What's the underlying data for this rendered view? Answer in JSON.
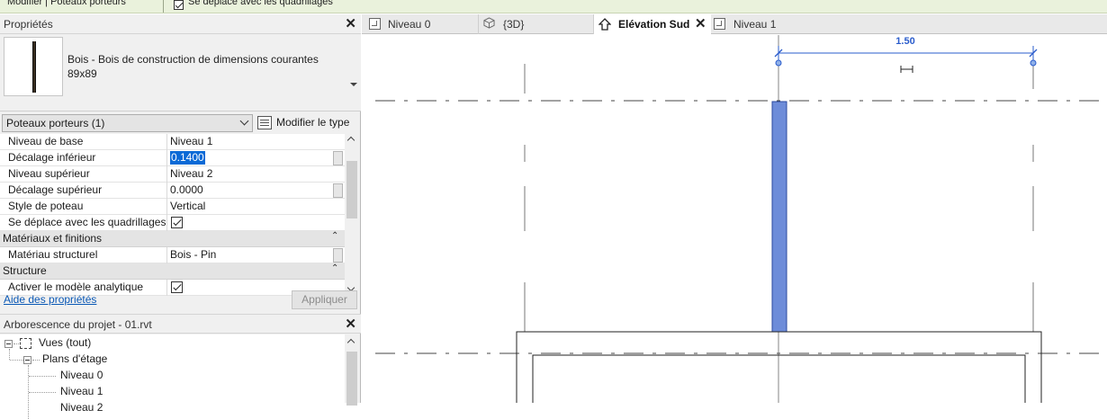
{
  "context_bar": {
    "title": "Modifier | Poteaux porteurs",
    "checkbox_label": "Se déplace avec les quadrillages",
    "checkbox_checked": true
  },
  "properties": {
    "title": "Propriétés",
    "close": "✕",
    "type_name": "Bois - Bois de construction de dimensions courantes",
    "type_size": "89x89",
    "selector": "Poteaux porteurs (1)",
    "edit_type": "Modifier le type",
    "rows": [
      {
        "kind": "param",
        "label": "Niveau de base",
        "value": "Niveau 1"
      },
      {
        "kind": "param",
        "label": "Décalage inférieur",
        "value": "0.1400",
        "selected": true
      },
      {
        "kind": "param",
        "label": "Niveau supérieur",
        "value": "Niveau 2"
      },
      {
        "kind": "param",
        "label": "Décalage supérieur",
        "value": "0.0000"
      },
      {
        "kind": "param",
        "label": "Style de poteau",
        "value": "Vertical"
      },
      {
        "kind": "check",
        "label": "Se déplace avec les quadrillages",
        "checked": true
      },
      {
        "kind": "group",
        "label": "Matériaux et finitions"
      },
      {
        "kind": "param",
        "label": "Matériau structurel",
        "value": "Bois - Pin"
      },
      {
        "kind": "group",
        "label": "Structure"
      },
      {
        "kind": "check",
        "label": "Activer le modèle analytique",
        "checked": true
      }
    ],
    "help_link": "Aide des propriétés",
    "apply": "Appliquer"
  },
  "browser": {
    "title": "Arborescence du projet - 01.rvt",
    "close": "✕",
    "nodes": [
      "Vues (tout)",
      "Plans d'étage",
      "Niveau 0",
      "Niveau 1",
      "Niveau 2"
    ]
  },
  "tabs": [
    {
      "label": "Niveau 0",
      "icon": "floor-plan-icon",
      "active": false
    },
    {
      "label": "{3D}",
      "icon": "3d-view-icon",
      "active": false
    },
    {
      "label": "Elévation Sud",
      "icon": "elevation-icon",
      "active": true
    },
    {
      "label": "Niveau 1",
      "icon": "floor-plan-icon",
      "active": false
    }
  ],
  "tab_close": "✕",
  "canvas": {
    "dimension_value": "1.50"
  },
  "colors": {
    "selected_post": "#6d8cd9",
    "dimension": "#2a5ccc",
    "selection_highlight": "#0b6ad6",
    "context_bar": "#eaf2dc"
  }
}
